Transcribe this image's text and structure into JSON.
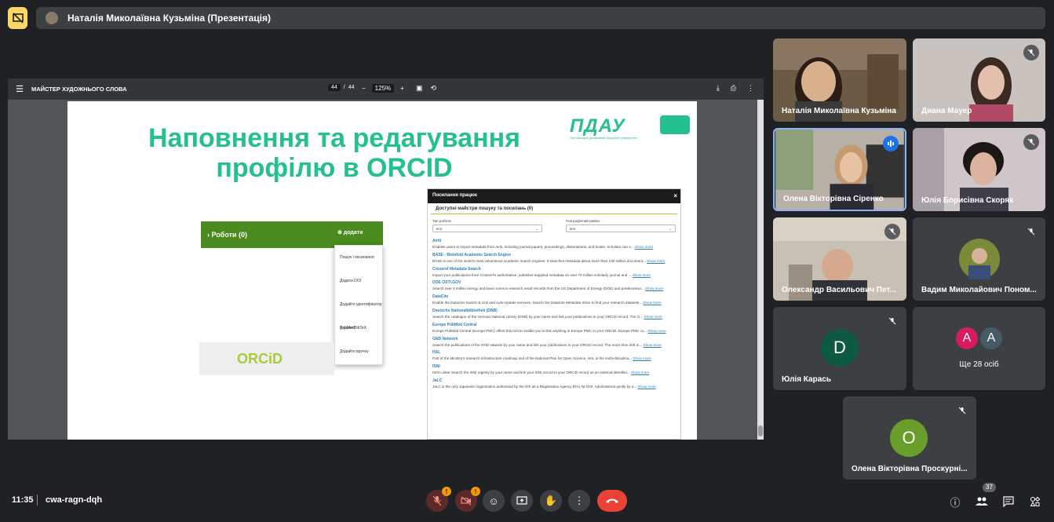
{
  "header": {
    "presenter_title": "Наталія Миколаївна Кузьміна (Презентація)"
  },
  "pdf": {
    "doc_title": "МАЙСТЕР ХУДОЖНЬОГО СЛОВА",
    "page_current": "44",
    "page_total": "44",
    "zoom": "125%",
    "minus": "−",
    "plus": "+"
  },
  "slide": {
    "heading_line1": "Наповнення та редагування",
    "heading_line2": "профілю в ORCID",
    "logo_text": "ПДАУ",
    "logo_sub": "Полтавський державний аграрний університет",
    "works_label": "› Роботи (0)",
    "works_add": "⊕ додати",
    "menu": [
      "Пошук і посилання",
      "Додати DOI",
      "Додайте ідентифікатор PubMed",
      "Додати BibTeX",
      "Додайте вручну"
    ],
    "orcid_text": "ORCiD",
    "panel": {
      "title": "Посилання працює",
      "close": "×",
      "subtitle": "Доступні майстри пошуку та посилань (0)",
      "filter1_label": "Тип роботи",
      "filter1_value": "все",
      "filter2_label": "Географічний район",
      "filter2_value": "все",
      "show_more": "Show more",
      "entries": [
        {
          "name": "Airiti",
          "desc": "Enables users to import metadata from Airiti, including journal papers, proceedings, dissertations, and books. Scholars can e..."
        },
        {
          "name": "BASE - Bielefeld Academic Search Engine",
          "desc": "BASE is one of the world's most voluminous academic search engines. It searches metadata about more than 100 million document..."
        },
        {
          "name": "Crossref Metadata Search",
          "desc": "Import your publications from Crossref's authoritative, publisher-supplied metadata on over 70 million scholarly journal and ..."
        },
        {
          "name": "DOE OSTI.GOV",
          "desc": "Search over 3 million energy and basic science research result records from the US Department of Energy (DOE) and predecessor..."
        },
        {
          "name": "DataCite",
          "desc": "Enable the DataCite Search & Link and Auto-Update services. Search the DataCite Metadata Store to find your research datasets..."
        },
        {
          "name": "Deutsche Nationalbibliothek (DNB)",
          "desc": "Search the catalogue of the German National Library (DNB) by your name and link your publications to your ORCID record. The G..."
        },
        {
          "name": "Europe PubMed Central",
          "desc": "Europe PubMed Central (Europe PMC) offers this tool to enable you to link anything in Europe PMC to your ORCID. Europe PMC co..."
        },
        {
          "name": "GND Network",
          "desc": "Search the publications of the GND network by your name and link your publications to your ORCID record. The more than 200 m..."
        },
        {
          "name": "HAL",
          "desc": "Part of the Ministry's research infrastructure roadmap and of the National Plan for Open Science, HAL is the multi-disciplina..."
        },
        {
          "name": "ISNI",
          "desc": "ISNI Linker Search the ISNI registry by your name and link your ISNI record to your ORCID record as an external identifier..."
        },
        {
          "name": "JaLC",
          "desc": "JaLC is the only Japanese organization authorized by the IDF as a Registration Agency (RA) for DOI. Administered jointly by a..."
        }
      ]
    }
  },
  "participants": [
    {
      "name": "Наталія Миколаївна Кузьміна"
    },
    {
      "name": "Диана Мауер"
    },
    {
      "name": "Олена Вікторівна Сіренко"
    },
    {
      "name": "Юлія Борисівна Скоряк"
    },
    {
      "name": "Олександр Васильович Пет..."
    },
    {
      "name": "Вадим Миколайович Поном..."
    },
    {
      "name": "Юлія Карась",
      "initial": "D"
    },
    {
      "name": "Олена Вікторівна Проскурні...",
      "initial": "O"
    }
  ],
  "more": {
    "a1": "A",
    "a2": "A",
    "label": "Ще 28 осіб"
  },
  "footer": {
    "time": "11:35",
    "meeting_code": "cwa-ragn-dqh",
    "people_count": "37",
    "warn": "!"
  }
}
